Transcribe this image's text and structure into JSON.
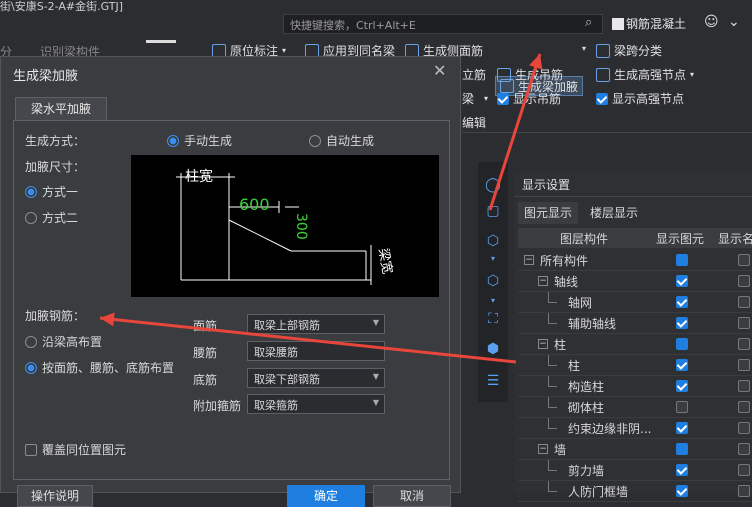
{
  "window": {
    "title": "街\\安康S-2-A#金街.GTJ]"
  },
  "search": {
    "placeholder": "快捷键搜索，Ctrl+Alt+E"
  },
  "product": {
    "label": "钢筋混凝土"
  },
  "ribbon": {
    "partial_left_1": "分",
    "partial_left_2": "识别梁构件",
    "partial_left_3": "原位标注",
    "apply_same_name": "应用到同名梁",
    "gen_side_rebar": "生成侧面筋",
    "gen_haunch": "生成梁加腋",
    "span_classify": "梁跨分类",
    "stand_bar": "立筋",
    "gen_hanger": "生成吊筋",
    "gen_hs_node": "生成高强节点",
    "beam": "梁",
    "show_hanger": "显示吊筋",
    "show_hs_node": "显示高强节点",
    "edit": "编辑"
  },
  "dialog": {
    "title": "生成梁加腋",
    "tab": "梁水平加腋",
    "gen_mode_label": "生成方式：",
    "manual": "手动生成",
    "auto": "自动生成",
    "size_label": "加腋尺寸：",
    "mode1": "方式一",
    "mode2": "方式二",
    "diagram": {
      "col_width": "柱宽",
      "len": "600",
      "height": "300",
      "beam_width": "梁宽"
    },
    "rebar_label": "加腋钢筋：",
    "along_height": "沿梁高布置",
    "by_bars": "按面筋、腰筋、底筋布置",
    "top_label": "面筋",
    "top_value": "取梁上部钢筋",
    "waist_label": "腰筋",
    "waist_value": "取梁腰筋",
    "bottom_label": "底筋",
    "bottom_value": "取梁下部钢筋",
    "stirrup_label": "附加箍筋",
    "stirrup_value": "取梁箍筋",
    "overwrite": "覆盖同位置图元",
    "btn_help": "操作说明",
    "btn_ok": "确定",
    "btn_cancel": "取消"
  },
  "display": {
    "title": "显示设置",
    "tab1": "图元显示",
    "tab2": "楼层显示",
    "col_layer": "图层构件",
    "col_show": "显示图元",
    "col_name": "显示名",
    "rows": [
      {
        "name": "所有构件",
        "level": 0,
        "tog": "−",
        "show": "square"
      },
      {
        "name": "轴线",
        "level": 1,
        "tog": "−",
        "show": "check"
      },
      {
        "name": "轴网",
        "level": 2,
        "show": "check"
      },
      {
        "name": "辅助轴线",
        "level": 2,
        "show": "check"
      },
      {
        "name": "柱",
        "level": 1,
        "tog": "−",
        "show": "square"
      },
      {
        "name": "柱",
        "level": 2,
        "show": "check"
      },
      {
        "name": "构造柱",
        "level": 2,
        "show": "check"
      },
      {
        "name": "砌体柱",
        "level": 2,
        "show": "empty"
      },
      {
        "name": "约束边缘非阴...",
        "level": 2,
        "show": "check"
      },
      {
        "name": "墙",
        "level": 1,
        "tog": "−",
        "show": "square"
      },
      {
        "name": "剪力墙",
        "level": 2,
        "show": "check"
      },
      {
        "name": "人防门框墙",
        "level": 2,
        "show": "check"
      }
    ]
  },
  "colors": {
    "accent": "#1e7fe0",
    "arrow": "#e8463a",
    "dim_green": "#3bd13b"
  }
}
